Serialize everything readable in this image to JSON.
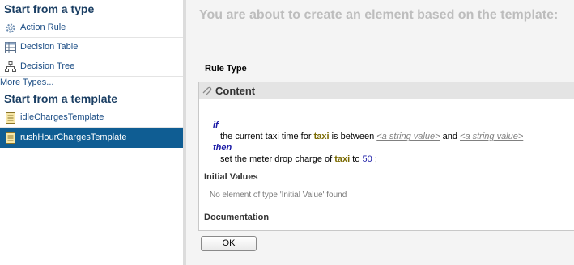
{
  "left": {
    "types_title": "Start from a type",
    "types": [
      {
        "label": "Action Rule",
        "icon": "gear-icon"
      },
      {
        "label": "Decision Table",
        "icon": "table-icon"
      },
      {
        "label": "Decision Tree",
        "icon": "tree-icon"
      }
    ],
    "more_types": "More Types...",
    "templates_title": "Start from a template",
    "templates": [
      {
        "label": "idleChargesTemplate",
        "icon": "template-icon",
        "selected": false
      },
      {
        "label": "rushHourChargesTemplate",
        "icon": "template-icon",
        "selected": true
      }
    ]
  },
  "main": {
    "heading": "You are about to create an element based on the template:",
    "rule_type_label": "Rule Type",
    "content_title": "Content",
    "rule": {
      "if_kw": "if",
      "l1_a": "the current taxi time for",
      "l1_var": "taxi",
      "l1_b": "is between",
      "l1_ph1": "<a string value>",
      "l1_and": "and",
      "l1_ph2": "<a string value>",
      "then_kw": "then",
      "l2_a": "set the meter drop charge of",
      "l2_var": "taxi",
      "l2_b": "to",
      "l2_num": "50",
      "l2_end": ";"
    },
    "initial_values_label": "Initial Values",
    "initial_values_empty": "No element of type 'Initial Value' found",
    "documentation_label": "Documentation",
    "ok_label": "OK"
  },
  "colors": {
    "selected_bg": "#0f5d93",
    "link": "#1a4c84",
    "keyword": "#1a1aa6",
    "variable": "#7a6a00"
  }
}
